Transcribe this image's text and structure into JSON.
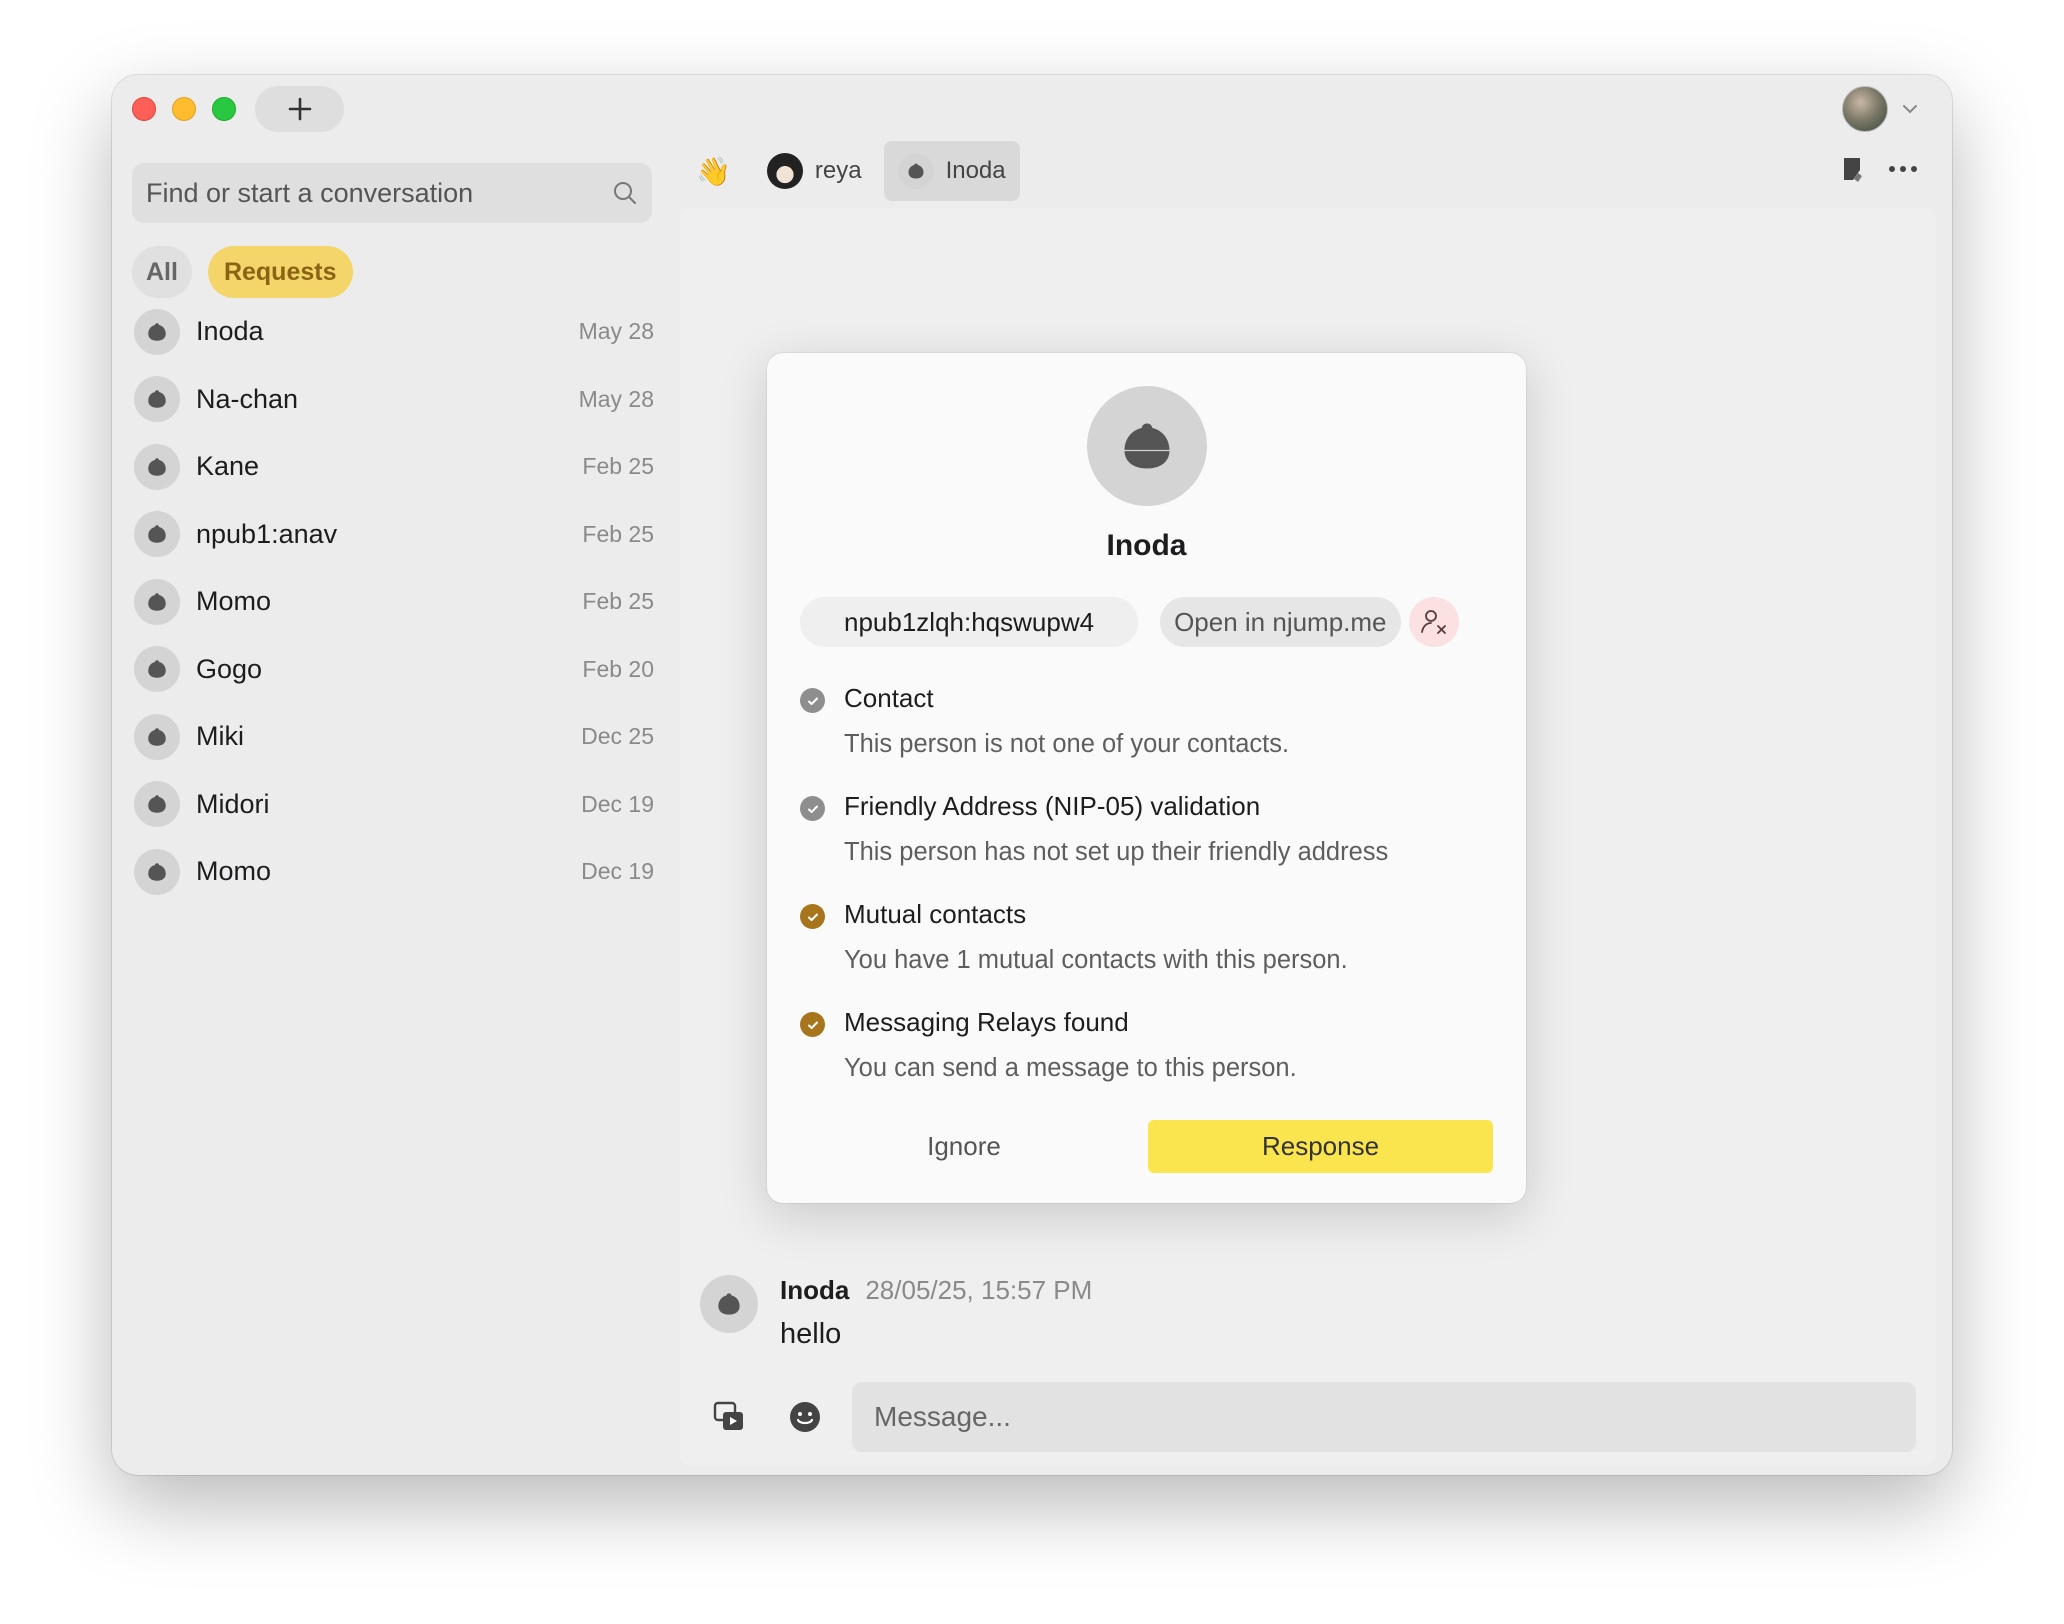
{
  "sidebar": {
    "search_placeholder": "Find or start a conversation",
    "filters": {
      "all": "All",
      "requests": "Requests"
    },
    "conversations": [
      {
        "name": "Inoda",
        "date": "May 28"
      },
      {
        "name": "Na-chan",
        "date": "May 28"
      },
      {
        "name": "Kane",
        "date": "Feb 25"
      },
      {
        "name": "npub1:anav",
        "date": "Feb 25"
      },
      {
        "name": "Momo",
        "date": "Feb 25"
      },
      {
        "name": "Gogo",
        "date": "Feb 20"
      },
      {
        "name": "Miki",
        "date": "Dec 25"
      },
      {
        "name": "Midori",
        "date": "Dec 19"
      },
      {
        "name": "Momo",
        "date": "Dec 19"
      }
    ]
  },
  "tabs": {
    "wave_icon": "👋",
    "reya": "reya",
    "inoda": "Inoda"
  },
  "modal": {
    "name": "Inoda",
    "npub": "npub1zlqh:hqswupw4",
    "njump": "Open in njump.me",
    "checks": [
      {
        "title": "Contact",
        "sub": "This person is not one of your contacts.",
        "state": "grey"
      },
      {
        "title": "Friendly Address (NIP-05) validation",
        "sub": "This person has not set up their friendly address",
        "state": "grey"
      },
      {
        "title": "Mutual contacts",
        "sub": "You have 1 mutual contacts with this person.",
        "state": "gold"
      },
      {
        "title": "Messaging Relays found",
        "sub": "You can send a message to this person.",
        "state": "gold"
      }
    ],
    "ignore": "Ignore",
    "response": "Response"
  },
  "message": {
    "author": "Inoda",
    "time": "28/05/25, 15:57 PM",
    "text": "hello"
  },
  "composer": {
    "placeholder": "Message..."
  },
  "colors": {
    "accent_yellow": "#fbe54e",
    "requests_chip": "#f4d56a",
    "check_gold": "#a7761c",
    "check_grey": "#8e8e8e"
  }
}
